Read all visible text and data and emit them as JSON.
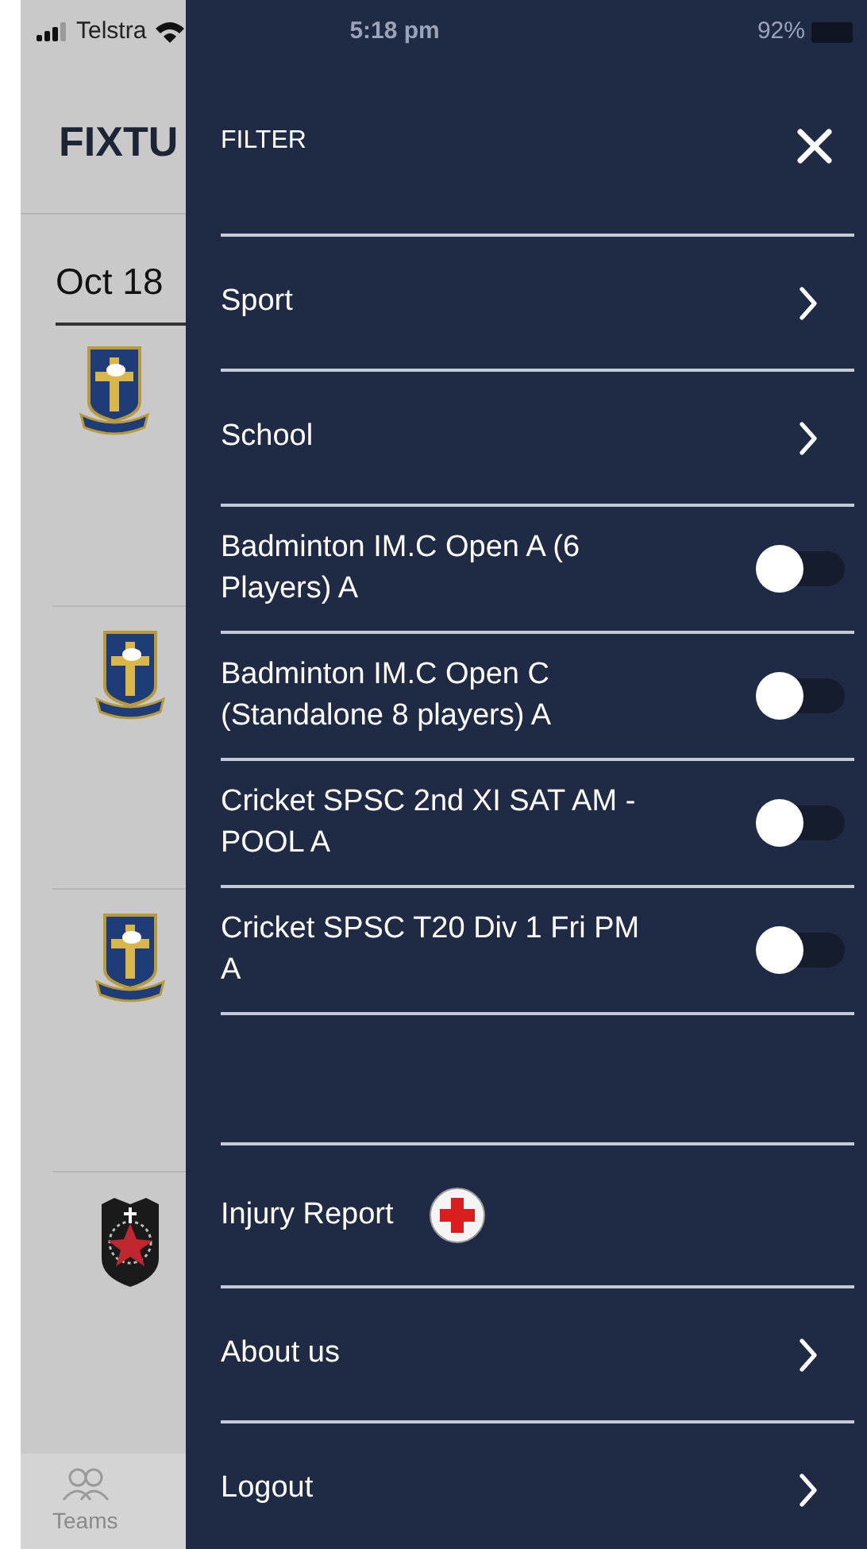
{
  "status_bar": {
    "carrier": "Telstra",
    "time": "5:18 pm",
    "battery": "92%"
  },
  "page": {
    "title": "FIXTU",
    "date": "Oct 18"
  },
  "fixtures": [
    {
      "kind": "cross"
    },
    {
      "kind": "cross"
    },
    {
      "kind": "cross"
    },
    {
      "kind": "shield"
    }
  ],
  "tab_bar": [
    {
      "label": "Teams"
    }
  ],
  "filter": {
    "title": "FILTER",
    "items": [
      {
        "kind": "link",
        "label": "Sport"
      },
      {
        "kind": "link",
        "label": "School"
      },
      {
        "kind": "toggle",
        "label": "Badminton IM.C Open A (6 Players) A",
        "on": false
      },
      {
        "kind": "toggle",
        "label": "Badminton IM.C Open C (Standalone 8 players) A",
        "on": false
      },
      {
        "kind": "toggle",
        "label": "Cricket SPSC 2nd XI SAT AM - POOL A",
        "on": false
      },
      {
        "kind": "toggle",
        "label": "Cricket SPSC T20 Div 1 Fri PM A",
        "on": false
      },
      {
        "kind": "blank"
      },
      {
        "kind": "injury",
        "label": "Injury Report"
      },
      {
        "kind": "link",
        "label": "About us"
      },
      {
        "kind": "link",
        "label": "Logout"
      }
    ]
  }
}
